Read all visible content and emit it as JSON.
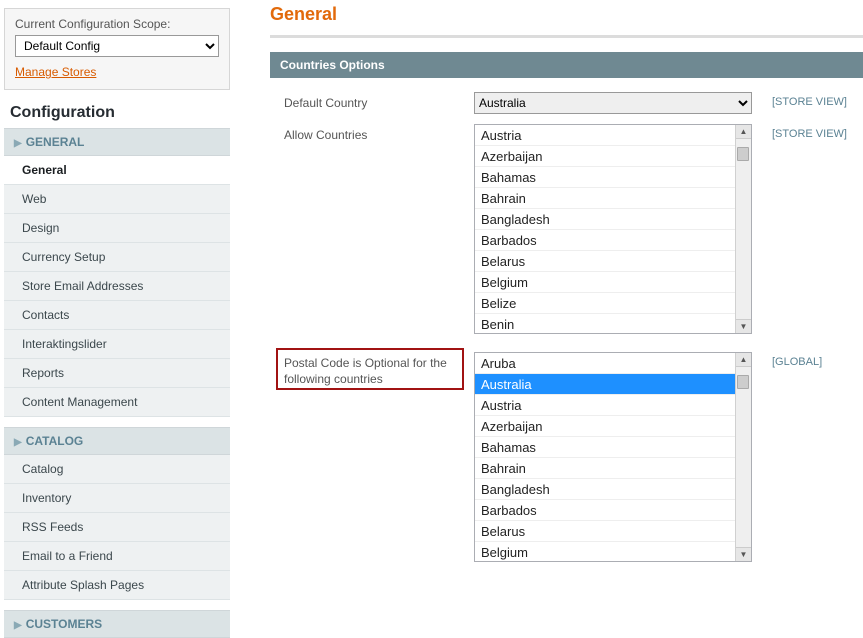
{
  "sidebar": {
    "scope_label": "Current Configuration Scope:",
    "scope_value": "Default Config",
    "manage_stores": "Manage Stores",
    "config_title": "Configuration",
    "sections": [
      {
        "name": "GENERAL",
        "items": [
          "General",
          "Web",
          "Design",
          "Currency Setup",
          "Store Email Addresses",
          "Contacts",
          "Interaktingslider",
          "Reports",
          "Content Management"
        ]
      },
      {
        "name": "CATALOG",
        "items": [
          "Catalog",
          "Inventory",
          "RSS Feeds",
          "Email to a Friend",
          "Attribute Splash Pages"
        ]
      },
      {
        "name": "CUSTOMERS",
        "items": []
      }
    ]
  },
  "page": {
    "title": "General",
    "fieldset_title": "Countries Options"
  },
  "rows": {
    "default_country": {
      "label": "Default Country",
      "value": "Australia",
      "scope": "[STORE VIEW]"
    },
    "allow_countries": {
      "label": "Allow Countries",
      "scope": "[STORE VIEW]",
      "options": [
        "Austria",
        "Azerbaijan",
        "Bahamas",
        "Bahrain",
        "Bangladesh",
        "Barbados",
        "Belarus",
        "Belgium",
        "Belize",
        "Benin"
      ]
    },
    "postal_optional": {
      "label": "Postal Code is Optional for the following countries",
      "scope": "[GLOBAL]",
      "options": [
        "Aruba",
        "Australia",
        "Austria",
        "Azerbaijan",
        "Bahamas",
        "Bahrain",
        "Bangladesh",
        "Barbados",
        "Belarus",
        "Belgium"
      ],
      "selected": "Australia"
    }
  }
}
